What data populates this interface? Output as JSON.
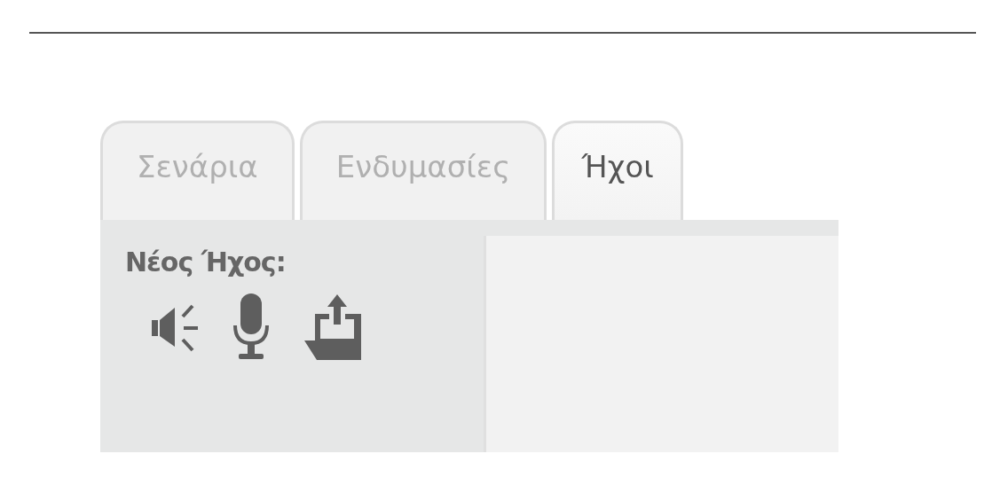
{
  "tabs": [
    {
      "label": "Σενάρια",
      "selected": false
    },
    {
      "label": "Ενδυμασίες",
      "selected": false
    },
    {
      "label": "Ήχοι",
      "selected": true
    }
  ],
  "new_sound": {
    "label": "Νέος Ήχος:"
  }
}
